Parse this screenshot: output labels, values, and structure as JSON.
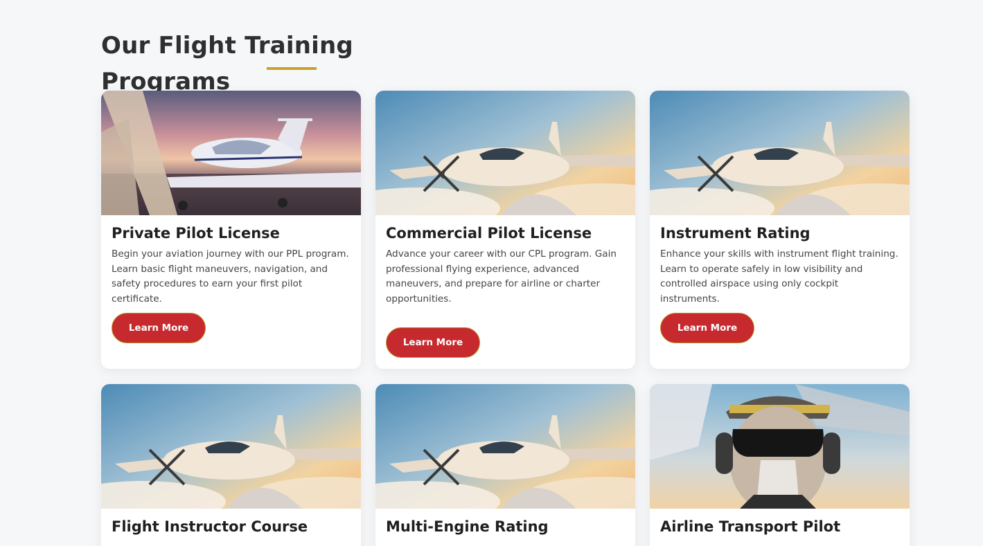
{
  "section": {
    "title": "Our Flight Training Programs",
    "accent_color": "#c9a227",
    "button_color": "#c62a2f"
  },
  "programs": [
    {
      "title": "Private Pilot License",
      "description": "Begin your aviation journey with our PPL program. Learn basic flight maneuvers, navigation, and safety procedures to earn your first pilot certificate.",
      "button_label": "Learn More",
      "image": "small-plane-sunset-photo"
    },
    {
      "title": "Commercial Pilot License",
      "description": "Advance your career with our CPL program. Gain professional flying experience, advanced maneuvers, and prepare for airline or charter opportunities.",
      "button_label": "Learn More",
      "image": "turboprop-above-clouds-photo"
    },
    {
      "title": "Instrument Rating",
      "description": "Enhance your skills with instrument flight training. Learn to operate safely in low visibility and controlled airspace using only cockpit instruments.",
      "button_label": "Learn More",
      "image": "turboprop-above-clouds-photo"
    },
    {
      "title": "Flight Instructor Course",
      "description": "",
      "button_label": "",
      "image": "turboprop-above-clouds-photo"
    },
    {
      "title": "Multi-Engine Rating",
      "description": "",
      "button_label": "",
      "image": "turboprop-above-clouds-photo"
    },
    {
      "title": "Airline Transport Pilot",
      "description": "",
      "button_label": "",
      "image": "pilot-portrait-photo"
    }
  ]
}
